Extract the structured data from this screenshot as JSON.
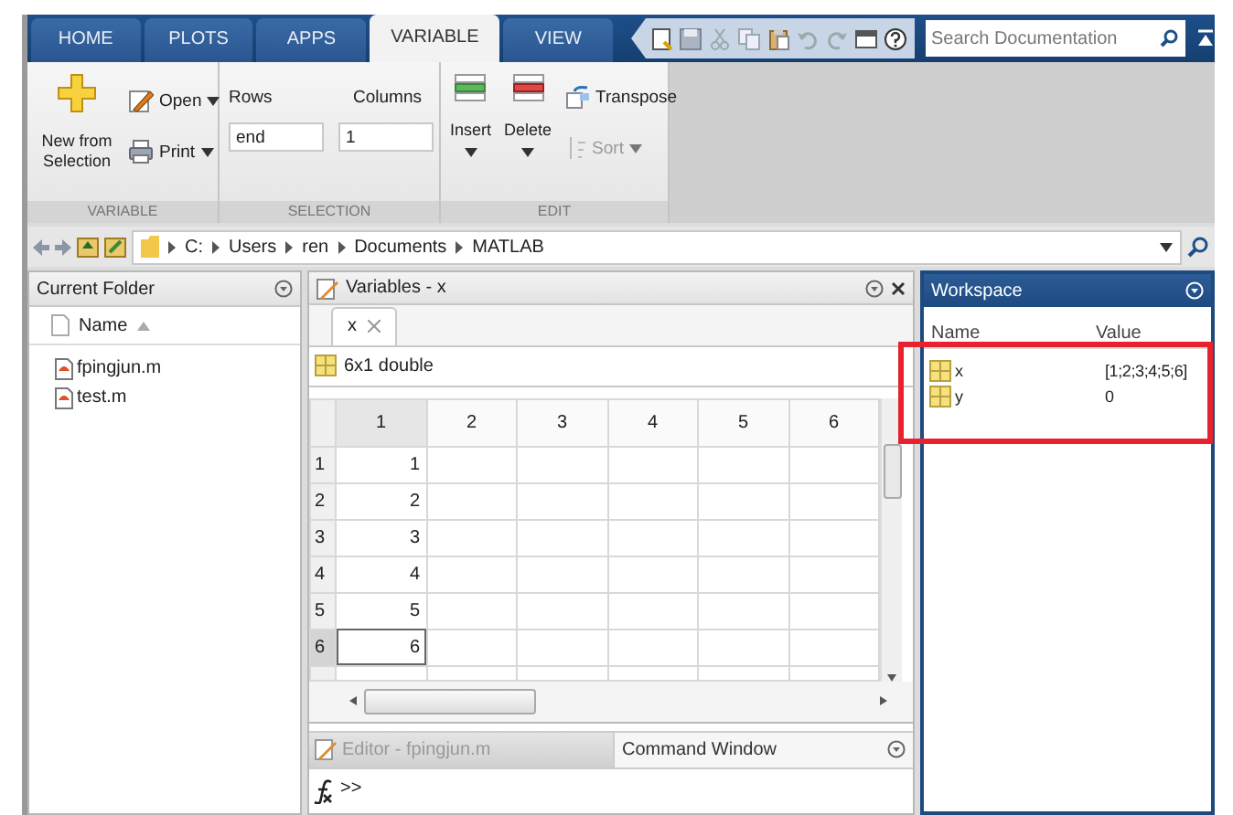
{
  "tabs": [
    {
      "label": "HOME",
      "selected": false
    },
    {
      "label": "PLOTS",
      "selected": false
    },
    {
      "label": "APPS",
      "selected": false
    },
    {
      "label": "VARIABLE",
      "selected": true
    },
    {
      "label": "VIEW",
      "selected": false
    }
  ],
  "search": {
    "placeholder": "Search Documentation"
  },
  "ribbon": {
    "variable_group": {
      "label": "VARIABLE",
      "new_from_selection": "New from Selection",
      "open": "Open",
      "print": "Print"
    },
    "selection_group": {
      "label": "SELECTION",
      "rows_label": "Rows",
      "rows_value": "end",
      "columns_label": "Columns",
      "columns_value": "1"
    },
    "edit_group": {
      "label": "EDIT",
      "insert": "Insert",
      "delete": "Delete",
      "transpose": "Transpose",
      "sort": {
        "label": "Sort",
        "disabled": true
      }
    }
  },
  "address": {
    "path": [
      "C:",
      "Users",
      "ren",
      "Documents",
      "MATLAB"
    ]
  },
  "current_folder": {
    "title": "Current Folder",
    "column": "Name",
    "files": [
      "fpingjun.m",
      "test.m"
    ]
  },
  "variables": {
    "title": "Variables - x",
    "tabs": [
      {
        "label": "x",
        "selected": true
      }
    ],
    "size_label": "6x1 double",
    "columns": [
      {
        "label": "1",
        "selected": true
      },
      {
        "label": "2",
        "selected": false
      },
      {
        "label": "3",
        "selected": false
      },
      {
        "label": "4",
        "selected": false
      },
      {
        "label": "5",
        "selected": false
      },
      {
        "label": "6",
        "selected": false
      }
    ],
    "rows": [
      {
        "header": "1",
        "value": "1",
        "selected": false
      },
      {
        "header": "2",
        "value": "2",
        "selected": false
      },
      {
        "header": "3",
        "value": "3",
        "selected": false
      },
      {
        "header": "4",
        "value": "4",
        "selected": false
      },
      {
        "header": "5",
        "value": "5",
        "selected": false
      },
      {
        "header": "6",
        "value": "6",
        "selected": true
      }
    ]
  },
  "bottom_tabs": [
    {
      "label": "Editor - fpingjun.m",
      "selected": false
    },
    {
      "label": "Command Window",
      "selected": true
    }
  ],
  "command_window": {
    "prompt": ">>"
  },
  "workspace": {
    "title": "Workspace",
    "columns": [
      "Name",
      "Value"
    ],
    "variables": [
      {
        "name": "x",
        "value": "[1;2;3;4;5;6]"
      },
      {
        "name": "y",
        "value": "0"
      }
    ]
  }
}
